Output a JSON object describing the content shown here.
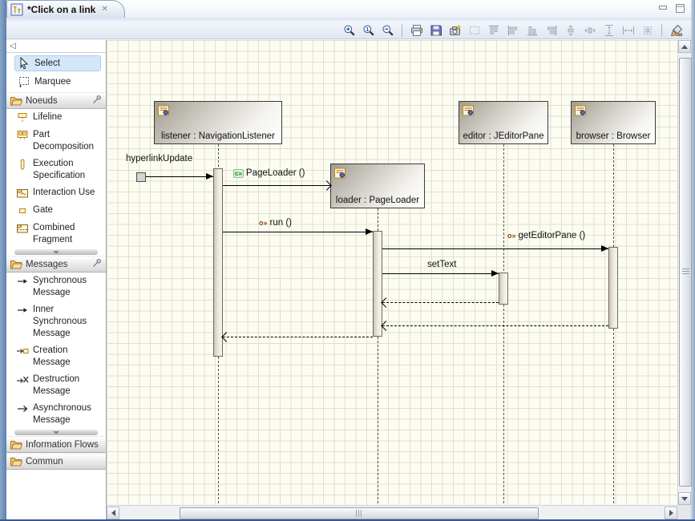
{
  "tab": {
    "title": "*Click on a link"
  },
  "icons": {
    "tab_close": "✕",
    "palette_collapse": "◁",
    "creation_badge": "c»",
    "sync_badge": "o»"
  },
  "window_controls": [
    "minimize",
    "maximize"
  ],
  "toolbar": {
    "buttons": [
      "zoom-in",
      "zoom-original",
      "zoom-out",
      "print",
      "save",
      "snapshot",
      "marquee-zoom",
      "align-top",
      "align-left",
      "align-bottom",
      "align-right",
      "distribute-vertical",
      "distribute-horizontal",
      "match-height",
      "match-width",
      "auto-size",
      "appearance"
    ]
  },
  "palette": {
    "tools": [
      {
        "label": "Select",
        "selected": true
      },
      {
        "label": "Marquee",
        "selected": false
      }
    ],
    "drawers": [
      {
        "label": "Noeuds",
        "expanded": true,
        "pinned": true,
        "items": [
          {
            "label": "Lifeline"
          },
          {
            "label": "Part Decomposition"
          },
          {
            "label": "Execution Specification"
          },
          {
            "label": "Interaction Use"
          },
          {
            "label": "Gate"
          },
          {
            "label": "Combined Fragment"
          }
        ]
      },
      {
        "label": "Messages",
        "expanded": true,
        "pinned": true,
        "items": [
          {
            "label": "Synchronous Message"
          },
          {
            "label": "Inner Synchronous Message"
          },
          {
            "label": "Creation Message"
          },
          {
            "label": "Destruction Message"
          },
          {
            "label": "Asynchronous Message"
          }
        ]
      },
      {
        "label": "Information Flows",
        "expanded": false,
        "items": []
      },
      {
        "label": "Commun",
        "expanded": false,
        "items": []
      }
    ]
  },
  "diagram": {
    "lifelines": [
      {
        "name": "listener : NavigationListener"
      },
      {
        "name": "loader : PageLoader"
      },
      {
        "name": "editor : JEditorPane"
      },
      {
        "name": "browser : Browser"
      }
    ],
    "messages": [
      {
        "label": "hyperlinkUpdate",
        "type": "found",
        "from": "environment",
        "to": "listener"
      },
      {
        "label": "PageLoader ()",
        "type": "creation",
        "from": "listener",
        "to": "loader"
      },
      {
        "label": "run ()",
        "type": "synchronous",
        "from": "listener",
        "to": "loader"
      },
      {
        "label": "getEditorPane ()",
        "type": "synchronous",
        "from": "loader",
        "to": "browser"
      },
      {
        "label": "setText",
        "type": "synchronous",
        "from": "loader",
        "to": "editor"
      },
      {
        "label": "",
        "type": "reply",
        "from": "editor",
        "to": "loader"
      },
      {
        "label": "",
        "type": "reply",
        "from": "browser",
        "to": "loader"
      },
      {
        "label": "",
        "type": "reply",
        "from": "loader",
        "to": "listener"
      }
    ]
  },
  "colors": {
    "canvas_bg": "#fcfcf2",
    "grid": "#e0e0cd",
    "frame_blue": "#5d82ad",
    "selection_blue": "#d4e7fa",
    "lifeline_border": "#3c3c34",
    "creation_green": "#1a7a1a"
  }
}
